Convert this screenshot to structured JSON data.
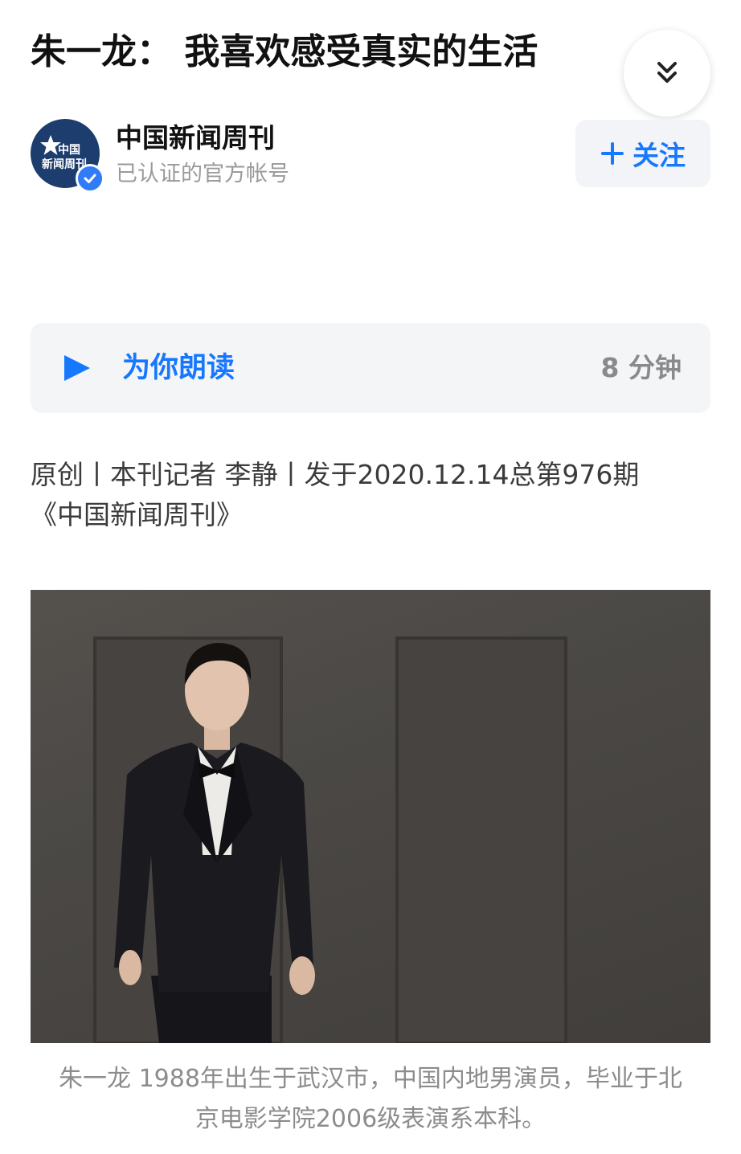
{
  "article": {
    "title": "朱一龙： 我喜欢感受真实的生活"
  },
  "author": {
    "name": "中国新闻周刊",
    "subtitle": "已认证的官方帐号",
    "avatar_text_line1": "中国",
    "avatar_text_line2": "新闻周刊",
    "follow_label": "关注"
  },
  "read_aloud": {
    "label": "为你朗读",
    "duration": "8 分钟"
  },
  "meta": {
    "line1": "原创丨本刊记者 李静丨发于2020.12.14总第976期",
    "line2": "《中国新闻周刊》"
  },
  "caption": "朱一龙 1988年出生于武汉市，中国内地男演员，毕业于北京电影学院2006级表演系本科。",
  "colors": {
    "accent": "#1677ff",
    "verified": "#2f7cf6",
    "avatar_bg": "#1c3d6e"
  },
  "icons": {
    "collapse": "double-chevron-down-icon",
    "follow": "plus-icon",
    "read": "play-icon",
    "verified": "check-badge-icon"
  }
}
